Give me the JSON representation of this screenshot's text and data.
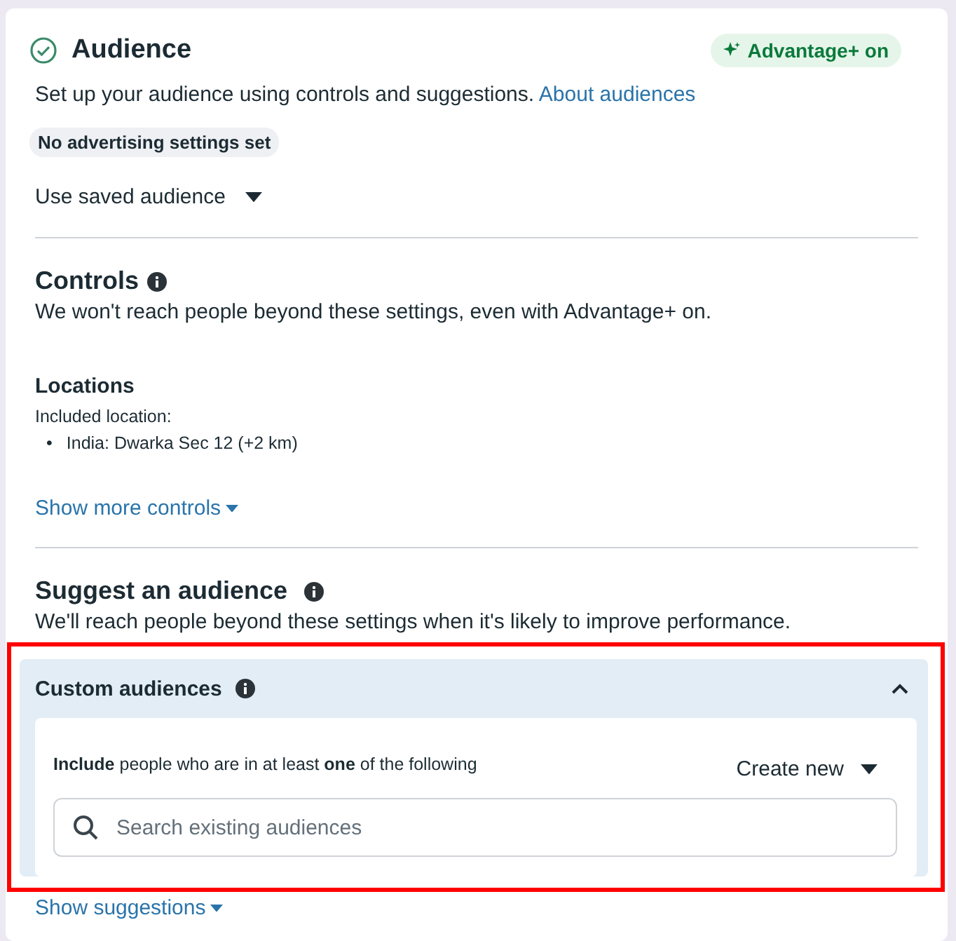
{
  "header": {
    "title": "Audience",
    "completed": true,
    "badge": "Advantage+ on"
  },
  "intro": {
    "text": "Set up your audience using controls and suggestions.",
    "link": "About audiences"
  },
  "status_tag": "No advertising settings set",
  "saved_audience": {
    "label": "Use saved audience"
  },
  "controls": {
    "title": "Controls",
    "description": "We won't reach people beyond these settings, even with Advantage+ on.",
    "locations": {
      "title": "Locations",
      "subtitle": "Included location:",
      "items": [
        {
          "bullet": "•",
          "text": "India: Dwarka Sec 12 (+2 km)"
        }
      ]
    },
    "more_link": "Show more controls"
  },
  "suggest": {
    "title": "Suggest an audience",
    "description": "We'll reach people beyond these settings when it's likely to improve performance."
  },
  "custom_audiences": {
    "title": "Custom audiences",
    "expanded": true,
    "highlighted": true,
    "include_text": "**Include** people who are in at least **one** of the following",
    "create_button": "Create new",
    "search": {
      "placeholder": "Search existing audiences"
    }
  },
  "suggestions_link": "Show suggestions"
}
